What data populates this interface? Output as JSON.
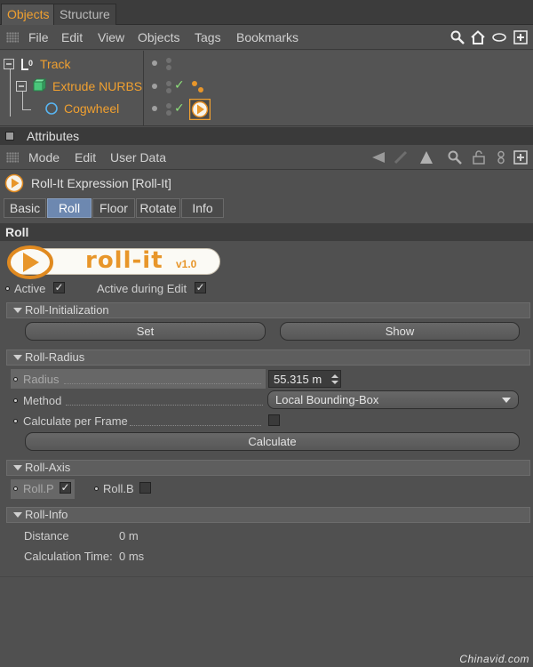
{
  "top_tabs": [
    {
      "label": "Objects",
      "active": true
    },
    {
      "label": "Structure",
      "active": false
    }
  ],
  "om_menu": [
    "File",
    "Edit",
    "View",
    "Objects",
    "Tags",
    "Bookmarks"
  ],
  "objects": [
    {
      "name": "Track",
      "type": "null-object"
    },
    {
      "name": "Extrude NURBS",
      "type": "extrude-nurbs"
    },
    {
      "name": "Cogwheel",
      "type": "cogwheel-spline"
    }
  ],
  "attributes": {
    "title": "Attributes",
    "menu": [
      "Mode",
      "Edit",
      "User Data"
    ],
    "object_title": "Roll-It Expression [Roll-It]",
    "tabs": [
      {
        "label": "Basic",
        "active": false
      },
      {
        "label": "Roll",
        "active": true
      },
      {
        "label": "Floor",
        "active": false
      },
      {
        "label": "Rotate",
        "active": false
      },
      {
        "label": "Info",
        "active": false
      }
    ],
    "section": "Roll",
    "logo_text": "roll-it",
    "logo_version": "v1.0"
  },
  "active_row": {
    "active_label": "Active",
    "active_checked": true,
    "active_edit_label": "Active during Edit",
    "active_edit_checked": true
  },
  "roll_init": {
    "header": "Roll-Initialization",
    "set_label": "Set",
    "show_label": "Show"
  },
  "roll_radius": {
    "header": "Roll-Radius",
    "radius_label": "Radius",
    "radius_value": "55.315 m",
    "method_label": "Method",
    "method_value": "Local Bounding-Box",
    "calc_per_frame_label": "Calculate per Frame",
    "calc_per_frame_checked": false,
    "calculate_label": "Calculate"
  },
  "roll_axis": {
    "header": "Roll-Axis",
    "p_label": "Roll.P",
    "p_checked": true,
    "b_label": "Roll.B",
    "b_checked": false
  },
  "roll_info": {
    "header": "Roll-Info",
    "distance_label": "Distance",
    "distance_value": "0 m",
    "calc_time_label": "Calculation Time:",
    "calc_time_value": "0 ms"
  },
  "watermark": "Chinavid.com",
  "colors": {
    "accent_orange": "#f0a030",
    "check_green": "#8de07a",
    "active_tab_blue": "#6d88b0"
  }
}
